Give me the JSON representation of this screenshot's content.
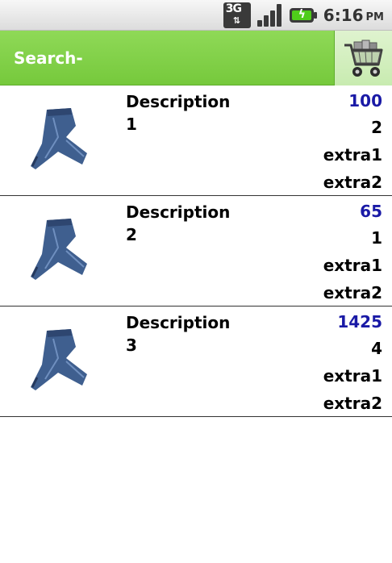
{
  "status_bar": {
    "network_label": "3G",
    "time": "6:16",
    "ampm": "PM"
  },
  "title_bar": {
    "title": "Search-"
  },
  "products": [
    {
      "description_word": "Description",
      "description_num": "1",
      "price": "100",
      "quantity": "2",
      "extra1": "extra1",
      "extra2": "extra2"
    },
    {
      "description_word": "Description",
      "description_num": "2",
      "price": "65",
      "quantity": "1",
      "extra1": "extra1",
      "extra2": "extra2"
    },
    {
      "description_word": "Description",
      "description_num": "3",
      "price": "1425",
      "quantity": "4",
      "extra1": "extra1",
      "extra2": "extra2"
    }
  ],
  "icons": {
    "cart": "shopping-cart-icon",
    "product": "jeans-icon",
    "network": "3g-data-icon",
    "signal": "signal-strength-icon",
    "battery": "battery-charging-icon"
  },
  "colors": {
    "title_bar": "#7fd047",
    "price_text": "#1a1aa6",
    "divider": "#333333"
  }
}
